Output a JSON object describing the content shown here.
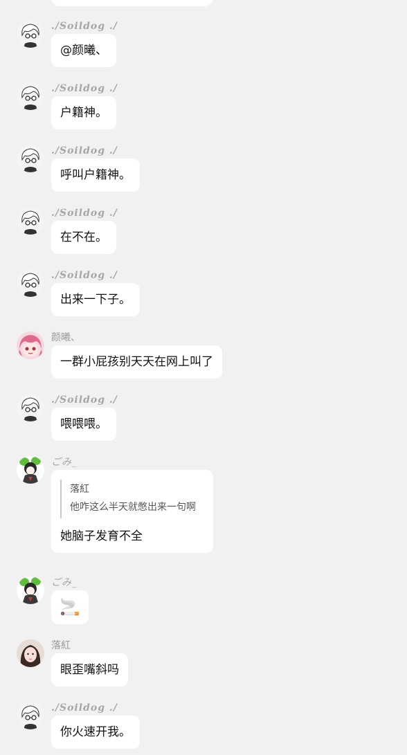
{
  "chat": {
    "messages": [
      {
        "sender": "./Soildog ./",
        "avatar_icon": "white-hair-anime-avatar-icon",
        "text": "@颜曦、"
      },
      {
        "sender": "./Soildog ./",
        "avatar_icon": "white-hair-anime-avatar-icon",
        "text": "户籍神。"
      },
      {
        "sender": "./Soildog ./",
        "avatar_icon": "white-hair-anime-avatar-icon",
        "text": "呼叫户籍神。"
      },
      {
        "sender": "./Soildog ./",
        "avatar_icon": "white-hair-anime-avatar-icon",
        "text": "在不在。"
      },
      {
        "sender": "./Soildog ./",
        "avatar_icon": "white-hair-anime-avatar-icon",
        "text": "出来一下子。"
      },
      {
        "sender": "颜曦、",
        "avatar_icon": "pink-hair-anime-avatar-icon",
        "text": "一群小屁孩别天天在网上叫了"
      },
      {
        "sender": "./Soildog ./",
        "avatar_icon": "white-hair-anime-avatar-icon",
        "text": "喂喂喂。"
      },
      {
        "sender": "ごみ_",
        "avatar_icon": "green-hair-anime-avatar-icon",
        "quote_name": "落紅",
        "quote_text": "他咋这么半天就憋出来一句啊",
        "text": "她脑子发育不全"
      },
      {
        "sender": "ごみ_",
        "avatar_icon": "green-hair-anime-avatar-icon",
        "emoji": "🚬"
      },
      {
        "sender": "落紅",
        "avatar_icon": "girl-photo-avatar-icon",
        "text": "眼歪嘴斜吗"
      },
      {
        "sender": "./Soildog ./",
        "avatar_icon": "white-hair-anime-avatar-icon",
        "text": "你火速开我。"
      }
    ]
  }
}
